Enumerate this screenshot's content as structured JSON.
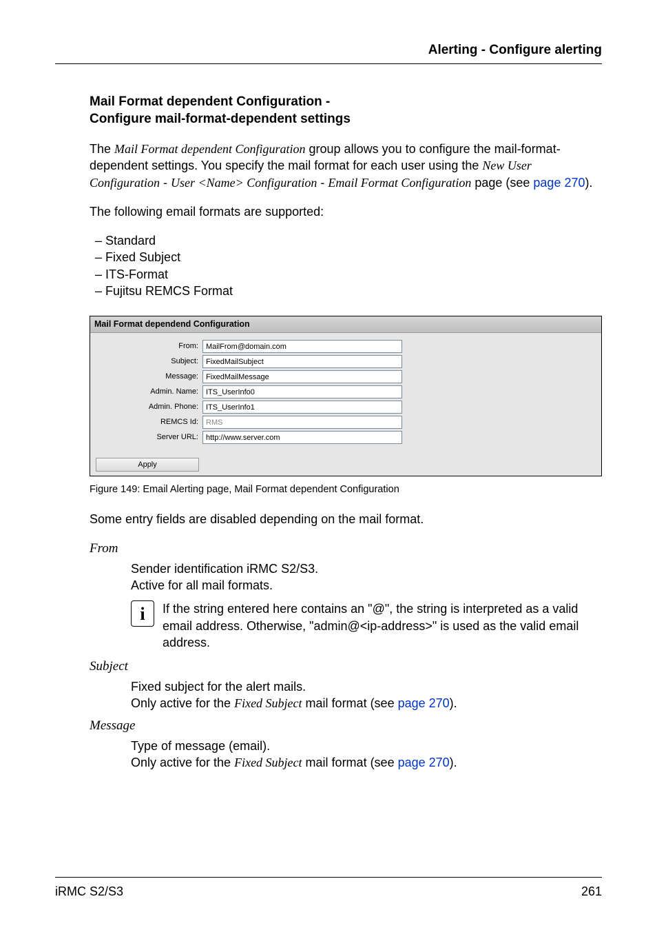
{
  "header": {
    "title": "Alerting - Configure alerting"
  },
  "section": {
    "heading_line1": "Mail Format dependent Configuration -",
    "heading_line2": "Configure mail-format-dependent settings"
  },
  "intro": {
    "p_a": "The ",
    "p_b_italic": "Mail Format dependent Configuration",
    "p_c": " group allows you to configure the mail-format-dependent settings. You specify the mail format for each user using the ",
    "p_d_italic": "New User Configuration",
    "p_e": " - ",
    "p_f_italic": "User <Name> Configuration",
    "p_g": " - ",
    "p_h_italic": "Email Format Configuration",
    "p_i": " page (see ",
    "p_j_link": "page 270",
    "p_k": ")."
  },
  "supported_line": "The following email formats are supported:",
  "formats": [
    "Standard",
    "Fixed Subject",
    "ITS-Format",
    "Fujitsu REMCS Format"
  ],
  "figure": {
    "panel_title": "Mail Format dependend Configuration",
    "rows": [
      {
        "label": "From:",
        "value": "MailFrom@domain.com",
        "disabled": false
      },
      {
        "label": "Subject:",
        "value": "FixedMailSubject",
        "disabled": false
      },
      {
        "label": "Message:",
        "value": "FixedMailMessage",
        "disabled": false
      },
      {
        "label": "Admin. Name:",
        "value": "ITS_UserInfo0",
        "disabled": false
      },
      {
        "label": "Admin. Phone:",
        "value": "ITS_UserInfo1",
        "disabled": false
      },
      {
        "label": "REMCS Id:",
        "value": "RMS",
        "disabled": true
      },
      {
        "label": "Server URL:",
        "value": "http://www.server.com",
        "disabled": false
      }
    ],
    "apply_label": "Apply",
    "caption": "Figure 149: Email Alerting page, Mail Format dependent Configuration"
  },
  "after_figure": "Some entry fields are disabled depending on the mail format.",
  "from": {
    "term": "From",
    "def1": "Sender identification iRMC S2/S3.",
    "def2": "Active for all mail formats.",
    "info": "If the string entered here contains an \"@\", the string is interpreted as a valid email address. Otherwise, \"admin@<ip-address>\" is used as the valid email address."
  },
  "subject": {
    "term": "Subject",
    "def1": "Fixed subject for the alert mails.",
    "def2a": "Only active for the ",
    "def2b_italic": "Fixed Subject",
    "def2c": " mail format (see ",
    "def2d_link": "page 270",
    "def2e": ")."
  },
  "message": {
    "term": "Message",
    "def1": "Type of message (email).",
    "def2a": "Only active for the ",
    "def2b_italic": "Fixed Subject",
    "def2c": " mail format (see ",
    "def2d_link": "page 270",
    "def2e": ")."
  },
  "footer": {
    "left": "iRMC S2/S3",
    "right": "261"
  }
}
